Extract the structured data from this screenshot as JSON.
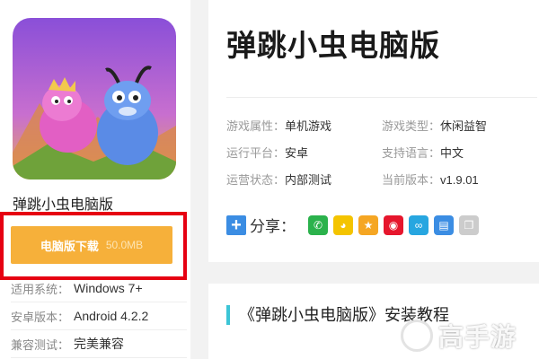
{
  "game": {
    "name": "弹跳小虫电脑版",
    "download_label": "电脑版下载",
    "download_size": "50.0MB"
  },
  "meta": [
    {
      "key": "适用系统：",
      "value": "Windows 7+"
    },
    {
      "key": "安卓版本：",
      "value": "Android 4.2.2"
    },
    {
      "key": "兼容测试：",
      "value": "完美兼容"
    }
  ],
  "detail": {
    "title": "弹跳小虫电脑版",
    "attributes": [
      [
        {
          "key": "游戏属性：",
          "value": "单机游戏"
        },
        {
          "key": "游戏类型：",
          "value": "休闲益智"
        }
      ],
      [
        {
          "key": "运行平台：",
          "value": "安卓"
        },
        {
          "key": "支持语言：",
          "value": "中文"
        }
      ],
      [
        {
          "key": "运营状态：",
          "value": "内部测试"
        },
        {
          "key": "当前版本：",
          "value": "v1.9.01"
        }
      ]
    ],
    "share_label": "分享："
  },
  "share_icons": [
    {
      "name": "wechat-icon",
      "color": "#2bb24c",
      "glyph": "✆"
    },
    {
      "name": "qq-icon",
      "color": "#f4c400",
      "glyph": "◕"
    },
    {
      "name": "qzone-icon",
      "color": "#f5a623",
      "glyph": "★"
    },
    {
      "name": "weibo-icon",
      "color": "#e6162d",
      "glyph": "◉"
    },
    {
      "name": "tencent-weibo-icon",
      "color": "#27a6e0",
      "glyph": "∞"
    },
    {
      "name": "print-icon",
      "color": "#3b8de3",
      "glyph": "▤"
    },
    {
      "name": "copy-icon",
      "color": "#cccccc",
      "glyph": "❐"
    }
  ],
  "guide": {
    "title": "《弹跳小虫电脑版》安装教程"
  },
  "watermark": {
    "text": "高手游"
  },
  "colors": {
    "download_button": "#f6b03a",
    "highlight_border": "#e60012",
    "accent_bar": "#3cc5d6"
  }
}
